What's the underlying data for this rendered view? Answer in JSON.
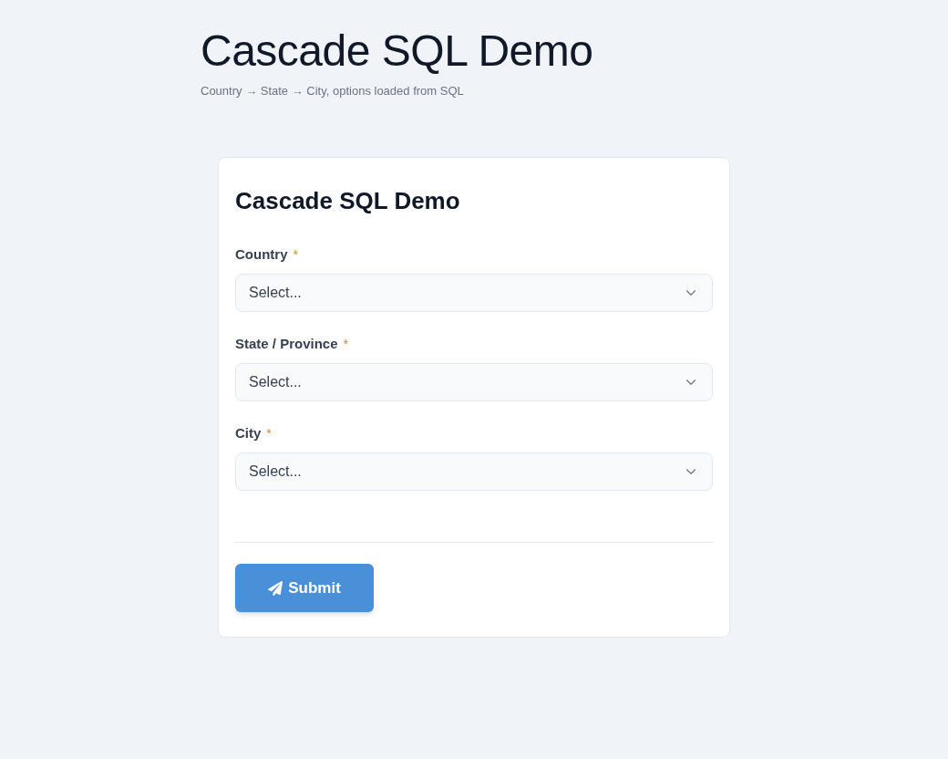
{
  "header": {
    "title": "Cascade SQL Demo",
    "subtitle": "Country → State → City, options loaded from SQL"
  },
  "form": {
    "title": "Cascade SQL Demo",
    "fields": [
      {
        "label": "Country",
        "required_mark": "*",
        "placeholder": "Select..."
      },
      {
        "label": "State / Province",
        "required_mark": "*",
        "placeholder": "Select..."
      },
      {
        "label": "City",
        "required_mark": "*",
        "placeholder": "Select..."
      }
    ],
    "submit_button": {
      "label": "Submit"
    }
  }
}
